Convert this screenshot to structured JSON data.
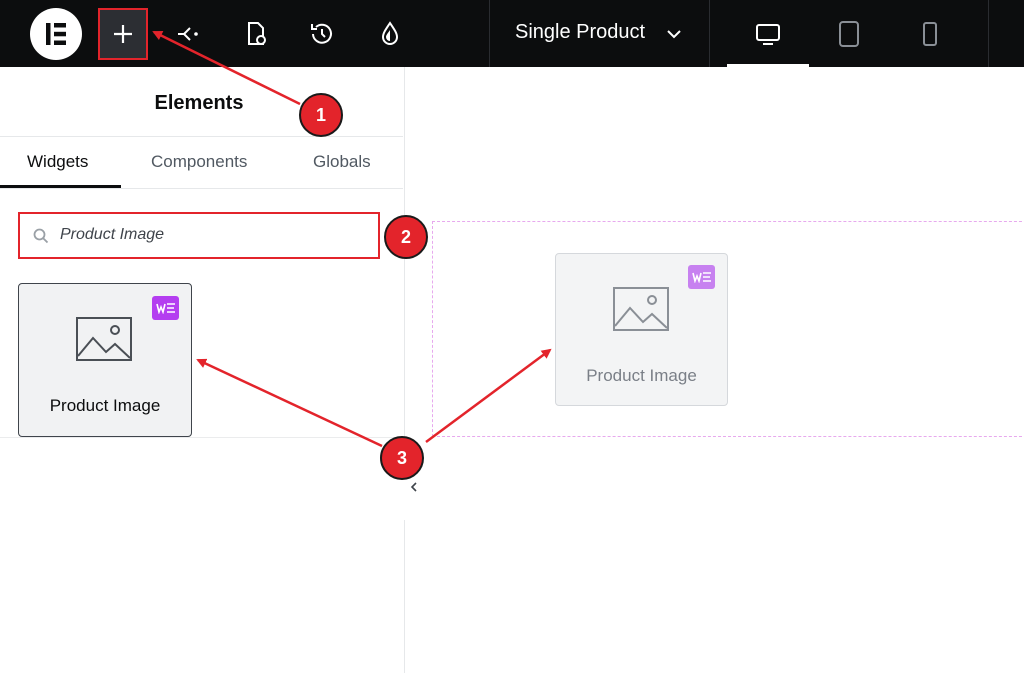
{
  "topbar": {
    "document_title": "Single Product",
    "icons": [
      "elementor-logo-icon",
      "add-element-icon",
      "structure-icon",
      "page-settings-icon",
      "history-icon",
      "site-settings-icon",
      "chevron-down-icon",
      "desktop-icon",
      "tablet-icon",
      "mobile-icon"
    ]
  },
  "panel": {
    "title": "Elements",
    "tabs": [
      {
        "label": "Widgets",
        "active": true
      },
      {
        "label": "Components",
        "active": false
      },
      {
        "label": "Globals",
        "active": false
      }
    ],
    "search": {
      "value": "Product Image",
      "placeholder": "Product Image"
    },
    "widgets": [
      {
        "label": "Product Image",
        "badge": "woo-pro-badge-icon"
      }
    ]
  },
  "canvas": {
    "widget": {
      "label": "Product Image"
    }
  },
  "callouts": [
    "1",
    "2",
    "3"
  ],
  "colors": {
    "topbar": "#0c0d0e",
    "highlight_red": "#e3242b",
    "pro_badge": "#b43ef0",
    "dashed_outline": "#e7a9ee"
  }
}
